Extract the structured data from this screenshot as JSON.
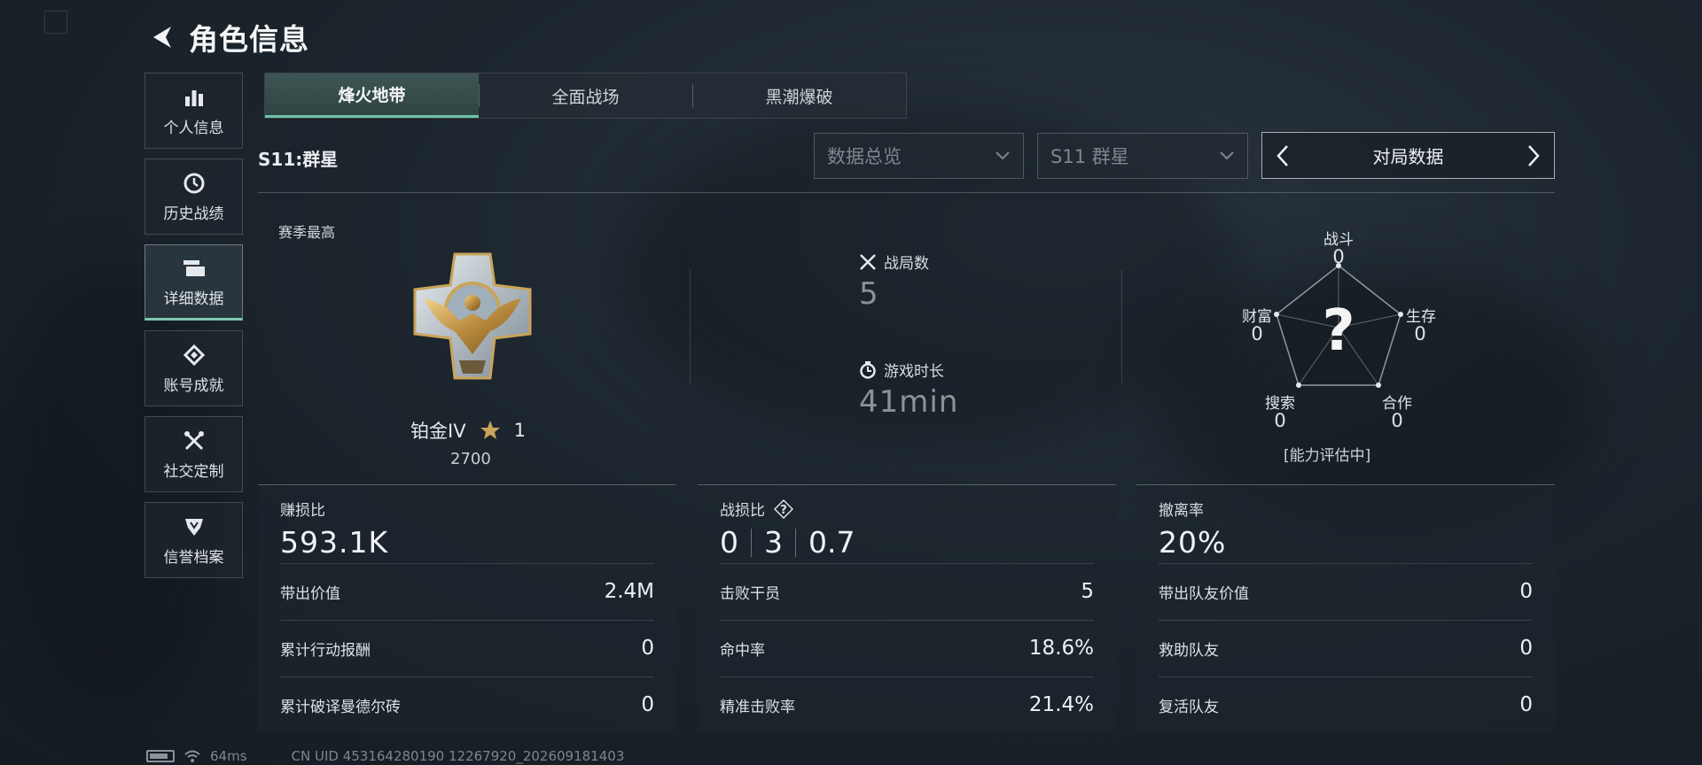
{
  "header": {
    "title": "角色信息"
  },
  "sidebar": {
    "items": [
      {
        "label": "个人信息",
        "icon": "bar-chart-icon"
      },
      {
        "label": "历史战绩",
        "icon": "clock-icon"
      },
      {
        "label": "详细数据",
        "icon": "cards-icon",
        "active": true
      },
      {
        "label": "账号成就",
        "icon": "achievement-icon"
      },
      {
        "label": "社交定制",
        "icon": "tools-icon"
      },
      {
        "label": "信誉档案",
        "icon": "shield-icon"
      }
    ]
  },
  "mode_tabs": [
    {
      "label": "烽火地带",
      "active": true
    },
    {
      "label": "全面战场",
      "active": false
    },
    {
      "label": "黑潮爆破",
      "active": false
    }
  ],
  "season": {
    "label": "S11:群星"
  },
  "filters": {
    "data_select": "数据总览",
    "season_select": "S11 群星",
    "switcher_label": "对局数据"
  },
  "rank": {
    "section_label": "赛季最高",
    "name": "铂金IV",
    "stars": "1",
    "points": "2700"
  },
  "summary": {
    "matches_label": "战局数",
    "matches_value": "5",
    "playtime_label": "游戏时长",
    "playtime_value": "41min"
  },
  "radar": {
    "center": "?",
    "note": "[能力评估中]",
    "axes": [
      {
        "label": "战斗",
        "value": "0"
      },
      {
        "label": "生存",
        "value": "0"
      },
      {
        "label": "合作",
        "value": "0"
      },
      {
        "label": "搜索",
        "value": "0"
      },
      {
        "label": "财富",
        "value": "0"
      }
    ]
  },
  "cards": {
    "profit": {
      "title": "赚损比",
      "value": "593.1K",
      "rows": [
        {
          "label": "带出价值",
          "value": "2.4M"
        },
        {
          "label": "累计行动报酬",
          "value": "0"
        },
        {
          "label": "累计破译曼德尔砖",
          "value": "0"
        }
      ]
    },
    "combat": {
      "title": "战损比",
      "help": "?",
      "ratio": [
        "0",
        "3",
        "0.7"
      ],
      "rows": [
        {
          "label": "击败干员",
          "value": "5"
        },
        {
          "label": "命中率",
          "value": "18.6%"
        },
        {
          "label": "精准击败率",
          "value": "21.4%"
        }
      ]
    },
    "extract": {
      "title": "撤离率",
      "value": "20%",
      "rows": [
        {
          "label": "带出队友价值",
          "value": "0"
        },
        {
          "label": "救助队友",
          "value": "0"
        },
        {
          "label": "复活队友",
          "value": "0"
        }
      ]
    }
  },
  "footer": {
    "ping": "64ms",
    "uid": "CN UID 453164280190 12267920_202609181403"
  },
  "colors": {
    "accent": "#6fc2a8",
    "gold": "#c9a45a"
  }
}
